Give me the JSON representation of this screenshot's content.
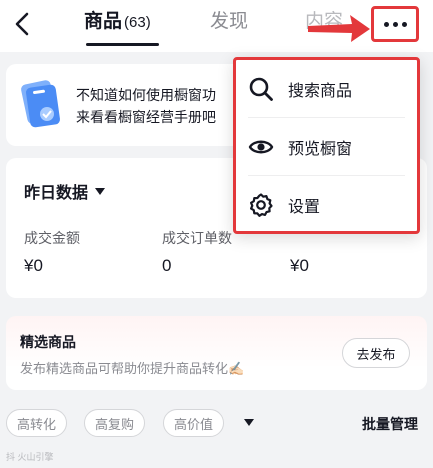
{
  "nav": {
    "tabs": [
      {
        "label": "商品",
        "count": "(63)"
      },
      {
        "label": "发现"
      },
      {
        "label": "内容"
      }
    ]
  },
  "manual": {
    "line1": "不知道如何使用橱窗功",
    "line2": "来看看橱窗经营手册吧"
  },
  "data_section": {
    "title": "昨日数据",
    "metrics": [
      {
        "label": "成交金额",
        "value": "¥0"
      },
      {
        "label": "成交订单数",
        "value": "0"
      },
      {
        "label": "",
        "value": "¥0"
      }
    ]
  },
  "featured": {
    "title": "精选商品",
    "description": "发布精选商品可帮助你提升商品转化✍🏻",
    "button": "去发布"
  },
  "filters": {
    "chips": [
      "高转化",
      "高复购",
      "高价值"
    ],
    "batch_manage": "批量管理"
  },
  "menu": {
    "items": [
      {
        "label": "搜索商品",
        "icon": "search-icon"
      },
      {
        "label": "预览橱窗",
        "icon": "eye-icon"
      },
      {
        "label": "设置",
        "icon": "gear-icon"
      }
    ]
  },
  "watermark": "抖 火山引擎",
  "colors": {
    "highlight": "#e3383b",
    "manual_icon": "#4b8cf5"
  }
}
